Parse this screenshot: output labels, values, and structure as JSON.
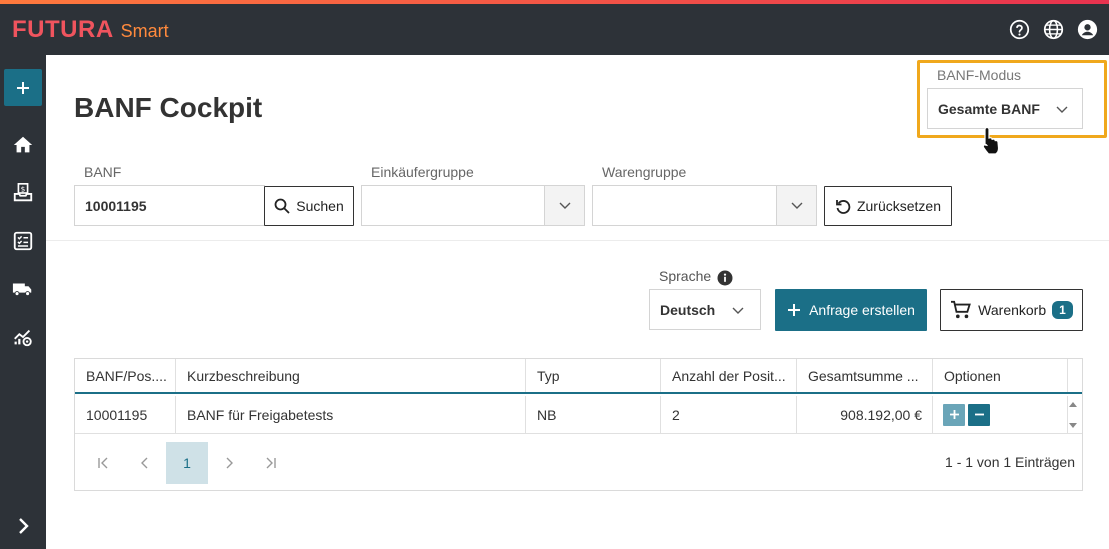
{
  "app": {
    "brand_main": "FUTURA",
    "brand_sub": "Smart",
    "header_icons": [
      "help-circle-icon",
      "globe-icon",
      "user-account-icon"
    ]
  },
  "sidebar": {
    "items": [
      "plus-icon",
      "home-icon",
      "inbox-money-icon",
      "checklist-icon",
      "truck-icon",
      "chart-settings-icon",
      "chevron-right-icon"
    ]
  },
  "page": {
    "title": "BANF Cockpit"
  },
  "mode": {
    "label": "BANF-Modus",
    "selected": "Gesamte BANF"
  },
  "filters": {
    "banf_label": "BANF",
    "banf_value": "10001195",
    "search_label": "Suchen",
    "buyer_group_label": "Einkäufergruppe",
    "buyer_group_value": "",
    "product_group_label": "Warengruppe",
    "product_group_value": "",
    "reset_label": "Zurücksetzen"
  },
  "actions": {
    "language_label": "Sprache",
    "language_value": "Deutsch",
    "create_request_label": "Anfrage erstellen",
    "cart_label": "Warenkorb",
    "cart_count": "1"
  },
  "grid": {
    "columns": [
      "BANF/Pos....",
      "Kurzbeschreibung",
      "Typ",
      "Anzahl der Posit...",
      "Gesamtsumme ...",
      "Optionen"
    ],
    "rows": [
      {
        "banf": "10001195",
        "description": "BANF für Freigabetests",
        "type": "NB",
        "count": "2",
        "total": "908.192,00 €"
      }
    ],
    "pager": {
      "current_page": "1",
      "info": "1 - 1 von 1 Einträgen"
    }
  },
  "colors": {
    "primary": "#1b6f87",
    "topbar": "#2d3238",
    "brand": "#f0545e",
    "highlight": "#f0a81c"
  }
}
